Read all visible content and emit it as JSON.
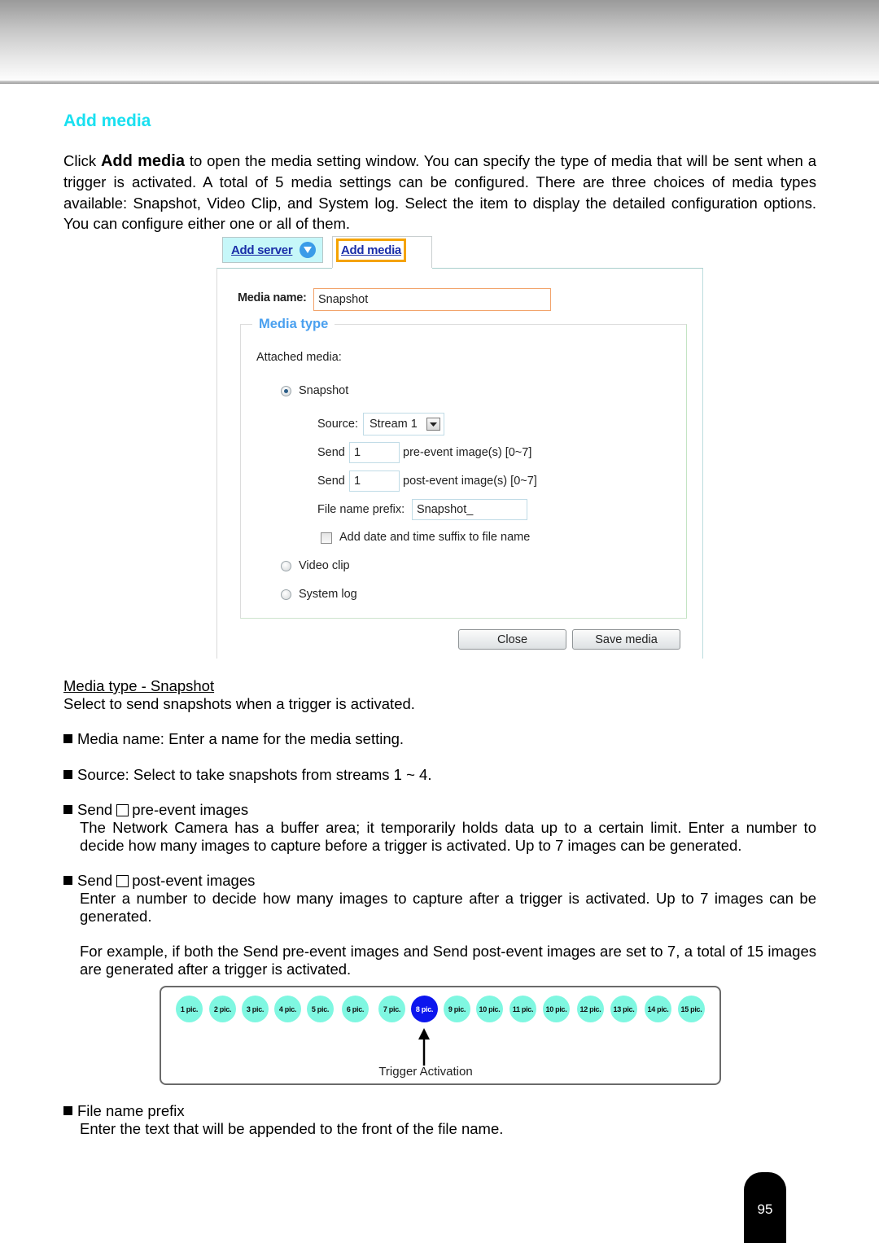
{
  "section": {
    "title": "Add media",
    "intro_prefix": "Click ",
    "intro_bold": "Add media",
    "intro_rest": " to open the media setting window. You can specify the type of media that will be sent when a trigger is activated. A total of 5 media settings can be configured. There are three choices of media types available: Snapshot, Video Clip, and System log. Select the item to display the detailed configuration options. You can configure either one or all of them."
  },
  "dialog": {
    "tabs": [
      {
        "label": "Add server",
        "icon": "chevron-down-circle-icon"
      },
      {
        "label": "Add media",
        "highlighted": true
      }
    ],
    "media_name_label": "Media name:",
    "media_name_value": "Snapshot",
    "fieldset_legend": "Media type",
    "attached_media_label": "Attached media:",
    "options": [
      {
        "label": "Snapshot",
        "checked": true
      },
      {
        "label": "Video clip",
        "checked": false
      },
      {
        "label": "System log",
        "checked": false
      }
    ],
    "source_label": "Source:",
    "source_value": "Stream 1",
    "send_label": "Send",
    "pre_event_value": "1",
    "pre_event_suffix": "pre-event image(s) [0~7]",
    "post_event_value": "1",
    "post_event_suffix": "post-event image(s) [0~7]",
    "prefix_label": "File name prefix:",
    "prefix_value": "Snapshot_",
    "suffix_checkbox_label": "Add date and time suffix to file name",
    "suffix_checked": false,
    "close_button": "Close",
    "save_button": "Save media"
  },
  "content": {
    "subheading": "Media type - Snapshot ",
    "subheading_desc": "Select to send snapshots when a trigger is activated.",
    "bullet_media_name": "Media name: Enter a name for the media setting.",
    "bullet_source": "Source: Select to take snapshots from streams 1 ~ 4.",
    "bullet_pre_send": "Send",
    "bullet_pre_rest": "pre-event images",
    "pre_desc": "The Network Camera has a buffer area; it temporarily holds data up to a certain limit. Enter a number to decide how many images to capture before a trigger is activated. Up to 7 images can be generated.",
    "bullet_post_send": "Send",
    "bullet_post_rest": "post-event images",
    "post_desc": "Enter a number to decide how many images to capture after a trigger is activated. Up to 7 images can be generated.",
    "example_desc": "For example, if both the Send pre-event images and Send post-event images are set to 7, a total of 15 images are generated after a trigger is activated.",
    "bullet_prefix": "File name prefix",
    "prefix_desc": "Enter the text that will be appended to the front of the file name."
  },
  "diagram": {
    "pics": [
      "1 pic.",
      "2 pic.",
      "3 pic.",
      "4 pic.",
      "5 pic.",
      "6 pic.",
      "7 pic.",
      "8 pic.",
      "9 pic.",
      "10 pic.",
      "11 pic.",
      "10 pic.",
      "12 pic.",
      "13 pic.",
      "14 pic.",
      "15 pic."
    ],
    "active_index": 7,
    "trigger_label": "Trigger Activation",
    "colors": {
      "pic": "#7ff7e1",
      "active": "#0c16ee"
    }
  },
  "page_number": "95",
  "colors": {
    "title": "#19e0f0",
    "tab_highlight": "#f5a300",
    "legend": "#4aa0ef"
  }
}
